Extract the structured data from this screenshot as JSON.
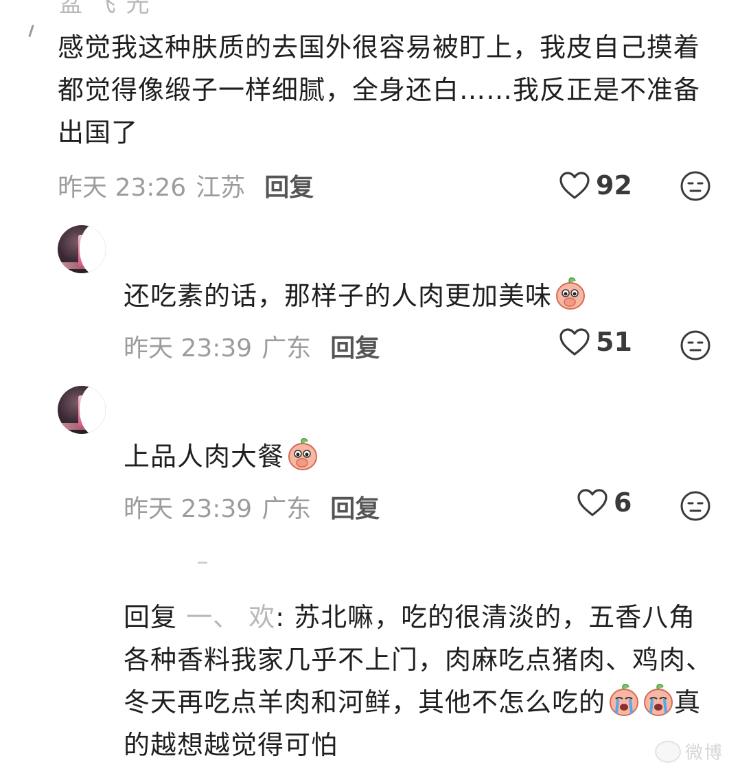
{
  "top_fragment": {
    "name_cropped": "盆 飞 光"
  },
  "comments": [
    {
      "text": "感觉我这种肤质的去国外很容易被盯上，我皮自己摸着都觉得像缎子一样细腻，全身还白……我反正是不准备出国了",
      "date": "昨天 23:26",
      "region": "江苏",
      "reply_label": "回复",
      "likes": "92"
    },
    {
      "text": "还吃素的话，那样子的人肉更加美味",
      "emoji": "peach-face-covering-mouth-emoji",
      "date": "昨天 23:39",
      "region": "广东",
      "reply_label": "回复",
      "likes": "51"
    },
    {
      "text": "上品人肉大餐",
      "emoji": "peach-face-covering-mouth-emoji",
      "date": "昨天 23:39",
      "region": "广东",
      "reply_label": "回复",
      "likes": "6"
    },
    {
      "reply_prefix": "回复",
      "reply_target": "一、  欢",
      "text_part1": ": 苏北嘛，吃的很清淡的，五香八角各种香料我家几乎不上门，肉麻吃点猪肉、鸡肉、冬天再吃点羊肉和河鲜，其他不怎么吃的",
      "emoji": "peach-crying-emoji",
      "text_part2": "真的越想越觉得可怕"
    }
  ],
  "watermark": {
    "text": "微博"
  },
  "colors": {
    "text": "#1f1f1f",
    "meta": "#9c9c9c",
    "reply": "#555555",
    "like": "#3a3a3a",
    "background": "#ffffff"
  }
}
